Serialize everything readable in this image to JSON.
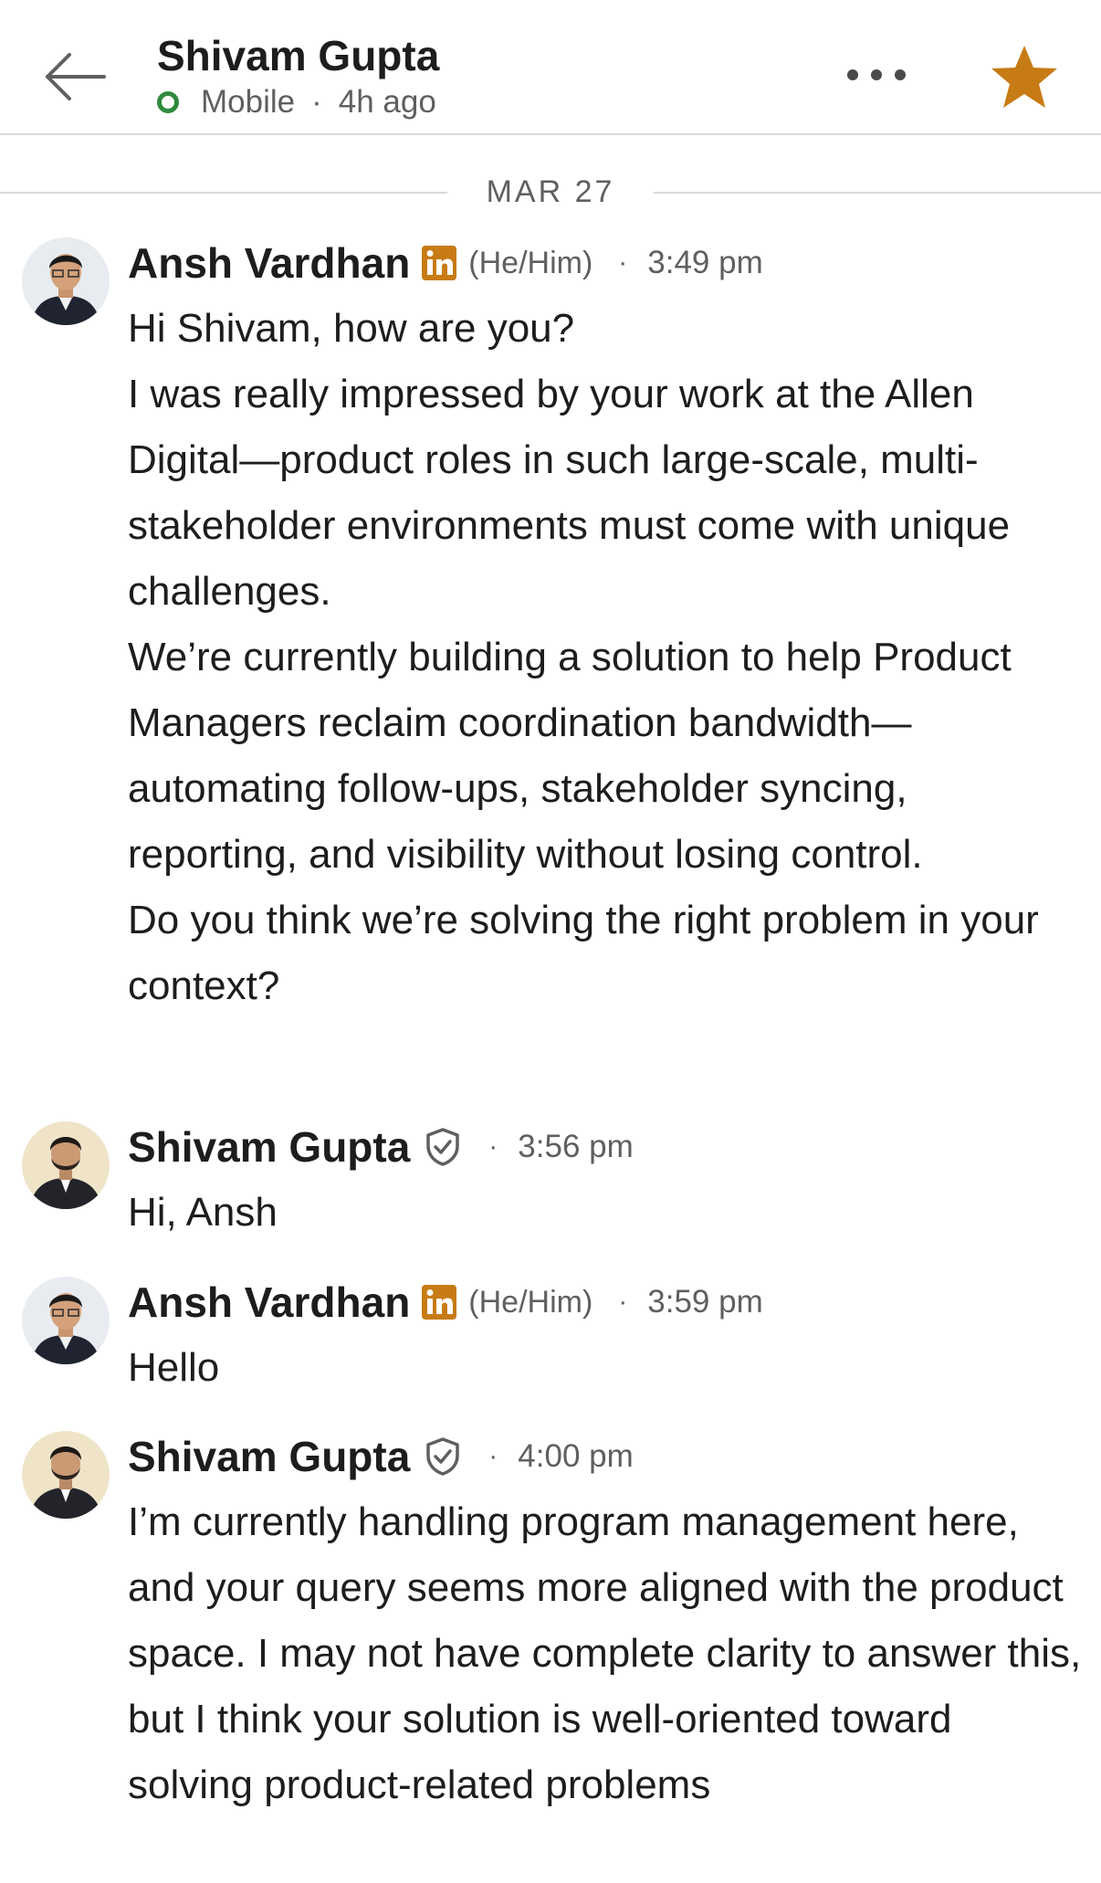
{
  "header": {
    "contact_name": "Shivam Gupta",
    "presence": "Mobile",
    "last_seen": "4h ago",
    "accent_star_color": "#c77b14",
    "presence_color": "#2e8a3e"
  },
  "date_divider": "MAR 27",
  "messages": [
    {
      "sender": "Ansh Vardhan",
      "pronouns": "(He/Him)",
      "time": "3:49 pm",
      "badge": "linkedin-premium-icon",
      "lines": [
        "Hi Shivam, how are you?",
        "I was really impressed by your work at the Allen Digital—product roles in such large-scale, multi-stakeholder environments must come with unique challenges.",
        "We’re currently building a solution to help Product Managers reclaim coordination bandwidth—automating follow-ups, stakeholder syncing, reporting, and visibility without losing control.",
        "Do you think we’re solving the right problem in your context?"
      ]
    },
    {
      "sender": "Shivam Gupta",
      "time": "3:56 pm",
      "badge": "verified-shield-icon",
      "lines": [
        "Hi, Ansh"
      ]
    },
    {
      "sender": "Ansh Vardhan",
      "pronouns": "(He/Him)",
      "time": "3:59 pm",
      "badge": "linkedin-premium-icon",
      "lines": [
        "Hello"
      ]
    },
    {
      "sender": "Shivam Gupta",
      "time": "4:00 pm",
      "badge": "verified-shield-icon",
      "lines": [
        "I’m currently handling program management here, and your query seems more aligned with the product space. I may not have complete clarity to answer this, but I think your solution is well-oriented toward solving product-related problems"
      ]
    }
  ]
}
